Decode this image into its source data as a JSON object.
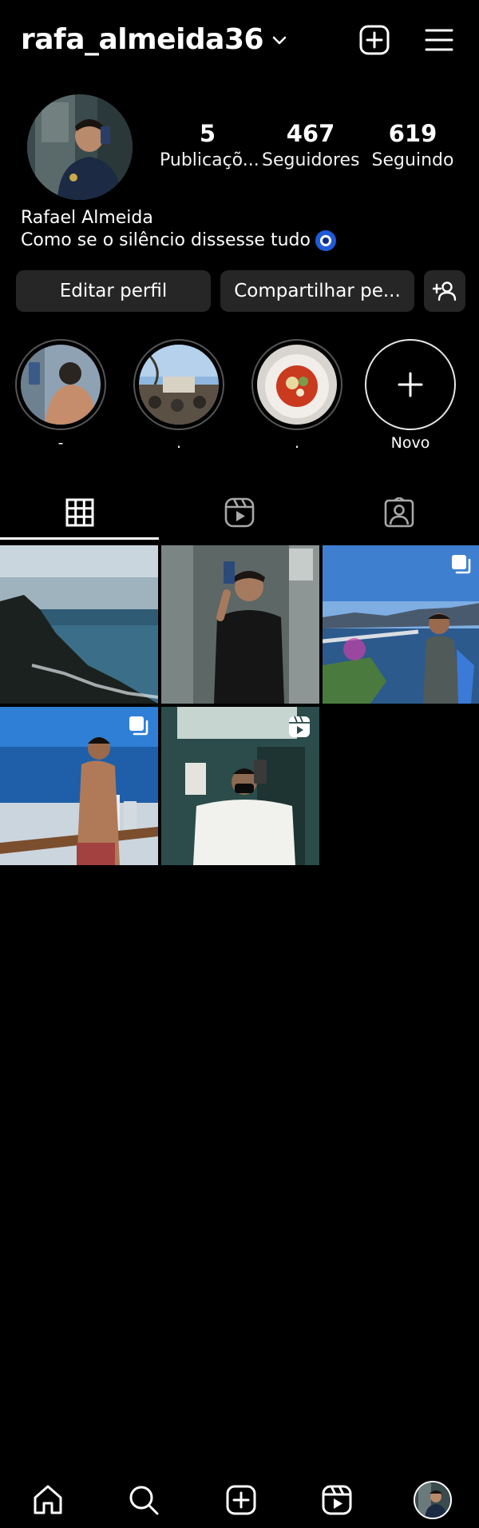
{
  "header": {
    "username": "rafa_almeida36"
  },
  "profile": {
    "stats": {
      "posts": {
        "count": "5",
        "label": "Publicaçõ..."
      },
      "followers": {
        "count": "467",
        "label": "Seguidores"
      },
      "following": {
        "count": "619",
        "label": "Seguindo"
      }
    },
    "name": "Rafael Almeida",
    "bio": "Como se o silêncio dissesse tudo"
  },
  "actions": {
    "edit_label": "Editar perfil",
    "share_label": "Compartilhar pe..."
  },
  "highlights": [
    {
      "caption": "-"
    },
    {
      "caption": "."
    },
    {
      "caption": "."
    },
    {
      "caption": "Novo",
      "icon": "plus-icon"
    }
  ],
  "tabs": [
    {
      "icon": "grid-icon",
      "active": true
    },
    {
      "icon": "reels-icon",
      "active": false
    },
    {
      "icon": "tagged-icon",
      "active": false
    }
  ],
  "posts": [
    {
      "type": "photo"
    },
    {
      "type": "photo"
    },
    {
      "type": "carousel",
      "badge_icon": "carousel-icon"
    },
    {
      "type": "carousel",
      "badge_icon": "carousel-icon"
    },
    {
      "type": "reel",
      "badge_icon": "reel-icon"
    }
  ],
  "nav": [
    {
      "icon": "home-icon"
    },
    {
      "icon": "search-icon"
    },
    {
      "icon": "new-post-icon"
    },
    {
      "icon": "reels-icon"
    },
    {
      "icon": "profile-avatar"
    }
  ],
  "colors": {
    "background": "#000000",
    "button": "#262626",
    "text": "#ffffff"
  }
}
